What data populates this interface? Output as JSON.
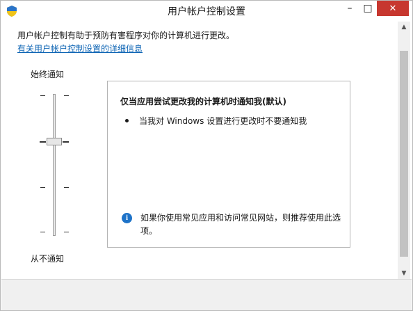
{
  "window": {
    "title": "用户帐户控制设置"
  },
  "icons": {
    "app": "uac-shield-icon",
    "minimize": "minimize-icon",
    "maximize": "maximize-icon",
    "close": "close-icon",
    "info": "info-icon",
    "scroll_up": "chevron-up-icon",
    "scroll_down": "chevron-down-icon"
  },
  "window_buttons": {
    "minimize": "–",
    "maximize": "□",
    "close": "✕"
  },
  "content": {
    "description": "用户帐户控制有助于预防有害程序对你的计算机进行更改。",
    "more_info_link": "有关用户帐户控制设置的详细信息"
  },
  "slider": {
    "label_top": "始终通知",
    "label_bottom": "从不通知",
    "levels": 4,
    "selected_level": 2
  },
  "panel": {
    "title": "仅当应用尝试更改我的计算机时通知我(默认)",
    "bullet": "当我对 Windows 设置进行更改时不要通知我",
    "recommendation": "如果你使用常见应用和访问常见网站，则推荐使用此选项。"
  },
  "colors": {
    "link": "#0d64b4",
    "close_button": "#c7372f",
    "info_icon": "#1e73c8"
  }
}
